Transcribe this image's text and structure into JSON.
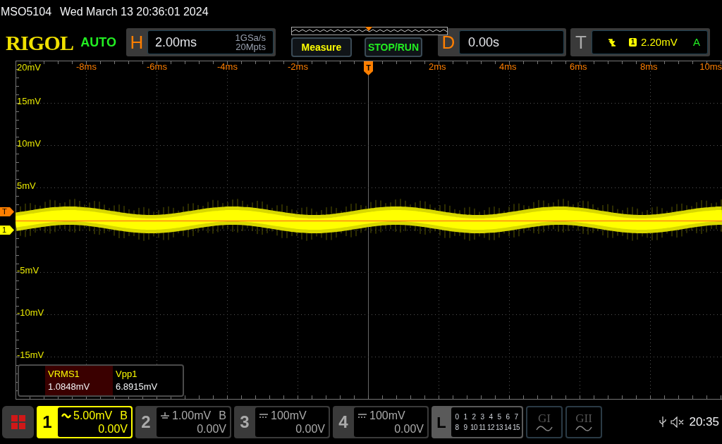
{
  "title_bar": {
    "model": "MSO5104",
    "datetime": "Wed March 13 20:36:01 2024"
  },
  "header": {
    "logo": "RIGOL",
    "mode": "AUTO",
    "horizontal": {
      "label": "H",
      "timebase": "2.00ms",
      "sample_rate": "1GSa/s",
      "memory_depth": "20Mpts"
    },
    "buttons": [
      {
        "label": "Measure",
        "kind": "measure"
      },
      {
        "label": "STOP/RUN",
        "kind": "run"
      }
    ],
    "delay": {
      "label": "D",
      "value": "0.00s"
    },
    "trigger": {
      "label": "T",
      "source": "1",
      "level": "2.20mV",
      "mode": "A"
    }
  },
  "graticule": {
    "y_labels": [
      "20mV",
      "15mV",
      "10mV",
      "5mV",
      "-5mV",
      "-10mV",
      "-15mV"
    ],
    "x_labels": [
      "-8ms",
      "-6ms",
      "-4ms",
      "-2ms",
      "2ms",
      "4ms",
      "6ms",
      "8ms",
      "10ms"
    ],
    "trigger_position_marker": "T",
    "level_markers": [
      {
        "label": "T",
        "color": "#ff7f00"
      },
      {
        "label": "1",
        "color": "#ffff00"
      }
    ]
  },
  "measurements": [
    {
      "name": "VRMS1",
      "value": "1.0848mV",
      "selected": true
    },
    {
      "name": "Vpp1",
      "value": "6.8915mV",
      "selected": false
    }
  ],
  "channels": [
    {
      "number": "1",
      "kind": "ac",
      "scale": "5.00mV",
      "bandwidth_limit": "B",
      "offset": "0.00V",
      "selected": true
    },
    {
      "number": "2",
      "kind": "ground",
      "scale": "1.00mV",
      "bandwidth_limit": "B",
      "offset": "0.00V",
      "selected": false
    },
    {
      "number": "3",
      "kind": "dc",
      "scale": "100mV",
      "offset": "0.00V",
      "selected": false
    },
    {
      "number": "4",
      "kind": "dc",
      "scale": "100mV",
      "offset": "0.00V",
      "selected": false
    }
  ],
  "logic": {
    "label": "L",
    "rows": [
      [
        "0",
        "1",
        "2",
        "3",
        "4",
        "5",
        "6",
        "7"
      ],
      [
        "8",
        "9",
        "10",
        "11",
        "12",
        "13",
        "14",
        "15"
      ]
    ]
  },
  "generators": [
    {
      "label": "GI"
    },
    {
      "label": "GII"
    }
  ],
  "status": {
    "time": "20:35"
  }
}
